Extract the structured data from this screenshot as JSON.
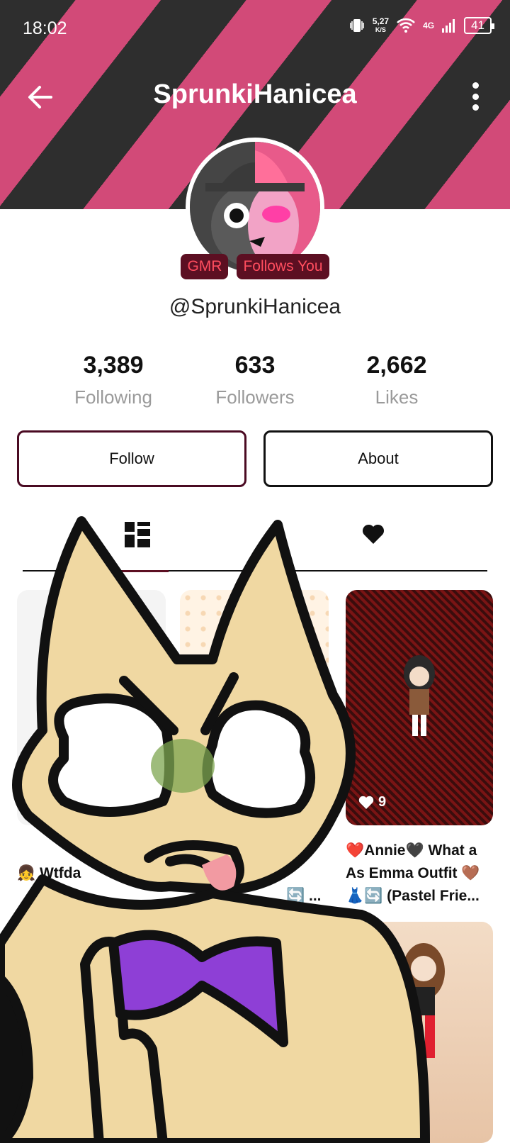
{
  "status_bar": {
    "time": "18:02",
    "net_speed_value": "5,27",
    "net_speed_unit": "K/S",
    "network_type": "4G",
    "battery": "41"
  },
  "header": {
    "title": "SprunkiHanicea"
  },
  "profile": {
    "badges": [
      "GMR",
      "Follows You"
    ],
    "handle": "@SprunkiHanicea",
    "stats": [
      {
        "value": "3,389",
        "label": "Following"
      },
      {
        "value": "633",
        "label": "Followers"
      },
      {
        "value": "2,662",
        "label": "Likes"
      }
    ],
    "follow_label": "Follow",
    "about_label": "About"
  },
  "tabs": {
    "grid_icon": "grid-icon",
    "likes_icon": "heart-icon"
  },
  "posts": {
    "card3_likes": "9",
    "captions": {
      "left": "👧 Wtfda",
      "mid": "🔄 ...",
      "right": "❤️Annie🖤 What a As Emma Outfit 🤎👗🔄 (Pastel Frie..."
    }
  },
  "colors": {
    "banner_pink": "#d24a78",
    "banner_dark": "#2e2e2e",
    "badge_bg": "#5c0f22",
    "badge_text": "#ff4d5e",
    "follow_border": "#4a0a22"
  }
}
